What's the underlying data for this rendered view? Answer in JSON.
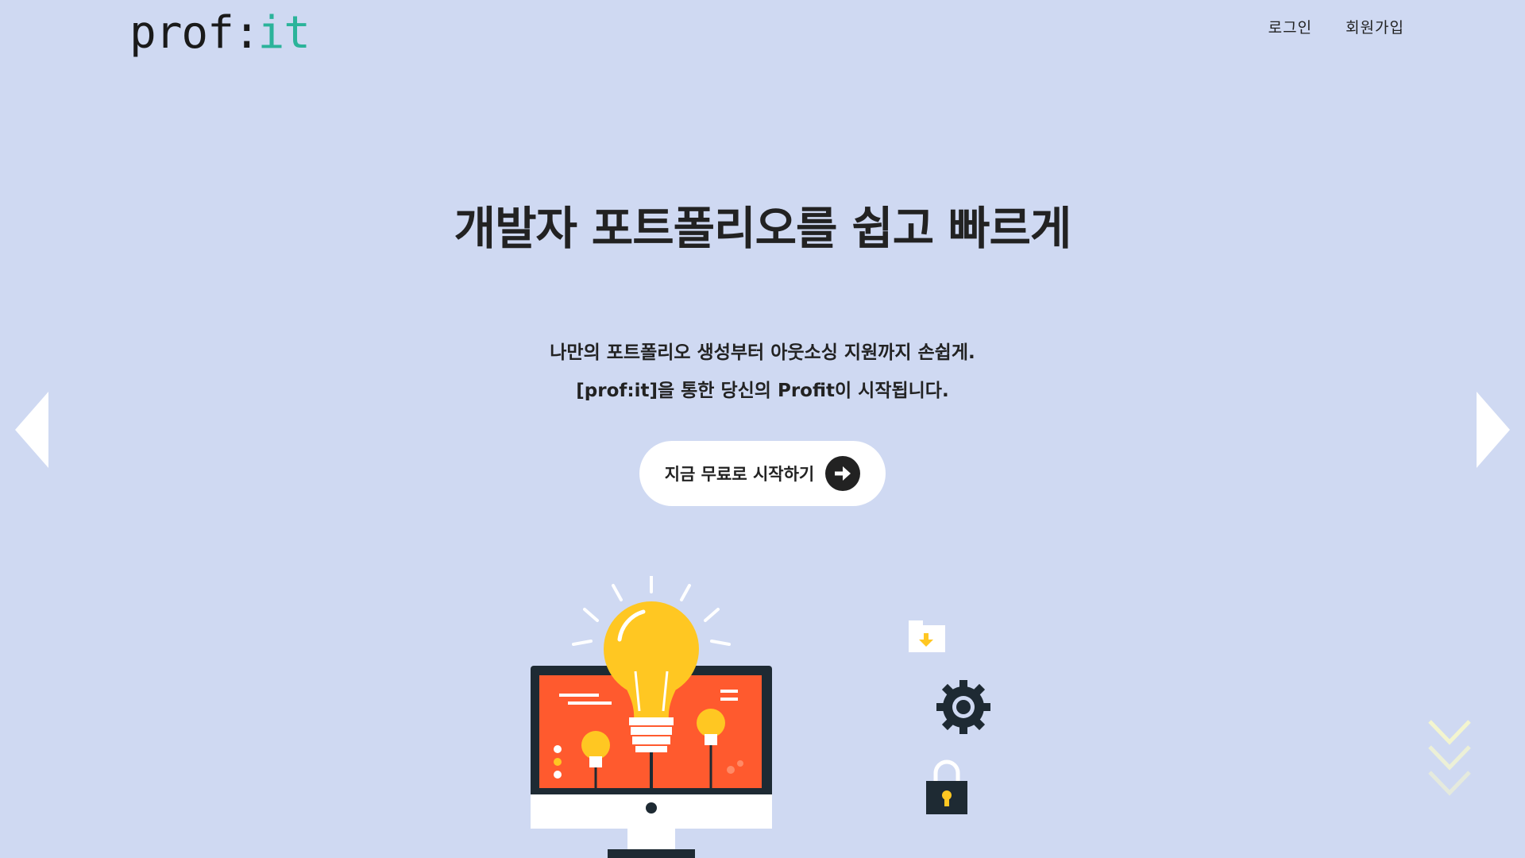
{
  "header": {
    "logo_text_main": "prof:",
    "logo_text_accent": "it",
    "nav": [
      {
        "label": "로그인"
      },
      {
        "label": "회원가입"
      }
    ]
  },
  "hero": {
    "headline": "개발자 포트폴리오를 쉽고 빠르게",
    "subline_1": "나만의 포트폴리오 생성부터 아웃소싱 지원까지 손쉽게.",
    "subline_2": "[prof:it]을 통한 당신의 Profit이 시작됩니다.",
    "cta_label": "지금 무료로 시작하기"
  },
  "icons": {
    "cta": "arrow-right-circle-icon",
    "carousel_prev": "triangle-left-icon",
    "carousel_next": "triangle-right-icon",
    "scroll": "chevrons-down-icon"
  },
  "colors": {
    "background": "#cfd9f2",
    "logo_accent": "#2bb39a",
    "cta_background": "#ffffff",
    "text": "#222222",
    "screen_orange": "#ff5a2e",
    "bulb_yellow": "#ffc722",
    "monitor_dark": "#1e2a33",
    "chevron_color": "#f3f5cf"
  }
}
